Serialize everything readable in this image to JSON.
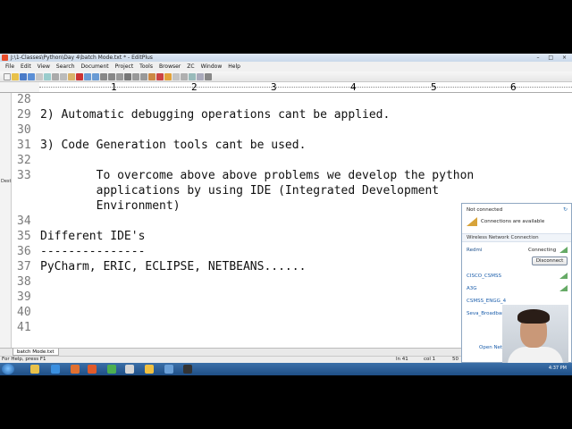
{
  "window": {
    "title": "J:\\1-Classes\\Python\\Day 4\\batch Mode.txt * - EditPlus",
    "controls": "– □ ×"
  },
  "menu": [
    "File",
    "Edit",
    "View",
    "Search",
    "Document",
    "Project",
    "Tools",
    "Browser",
    "ZC",
    "Window",
    "Help"
  ],
  "ruler": {
    "numbers": [
      "1",
      "2",
      "3",
      "4",
      "5",
      "6"
    ]
  },
  "left_panel": {
    "label": "Dest"
  },
  "editor": {
    "lines": [
      {
        "n": "28",
        "text": ""
      },
      {
        "n": "29",
        "text": "2) Automatic debugging operations cant be applied."
      },
      {
        "n": "30",
        "text": ""
      },
      {
        "n": "31",
        "text": "3) Code Generation tools cant be used."
      },
      {
        "n": "32",
        "text": ""
      },
      {
        "n": "33",
        "text": "        To overcome above above problems we develop the python"
      },
      {
        "n": "",
        "text": "        applications by using IDE (Integrated Development"
      },
      {
        "n": "",
        "text": "        Environment)"
      },
      {
        "n": "34",
        "text": ""
      },
      {
        "n": "35",
        "text": "Different IDE's"
      },
      {
        "n": "36",
        "text": "---------------"
      },
      {
        "n": "37",
        "text": "PyCharm, ERIC, ECLIPSE, NETBEANS......"
      },
      {
        "n": "38",
        "text": ""
      },
      {
        "n": "39",
        "text": ""
      },
      {
        "n": "40",
        "text": ""
      },
      {
        "n": "41",
        "text": ""
      }
    ]
  },
  "tab": {
    "label": "batch Mode.txt"
  },
  "status": {
    "help": "For Help, press F1",
    "line": "ln 41",
    "col": "col 1",
    "count": "50"
  },
  "network": {
    "status": "Not connected",
    "available": "Connections are available",
    "section": "Wireless Network Connection",
    "connected_name": "Redmi",
    "connecting": "Connecting",
    "disconnect": "Disconnect",
    "networks": [
      "CISCO_CSMSS",
      "A3G",
      "CSMSS_ENGG_4",
      "Seva_Broadband"
    ],
    "footer_link": "Open Netw"
  },
  "taskbar": {
    "time": "4:37 PM"
  },
  "colors": {
    "editor_text": "#111111",
    "line_numbers": "#7a7a7a",
    "taskbar": "#2a5d96",
    "link": "#1a5dab"
  }
}
